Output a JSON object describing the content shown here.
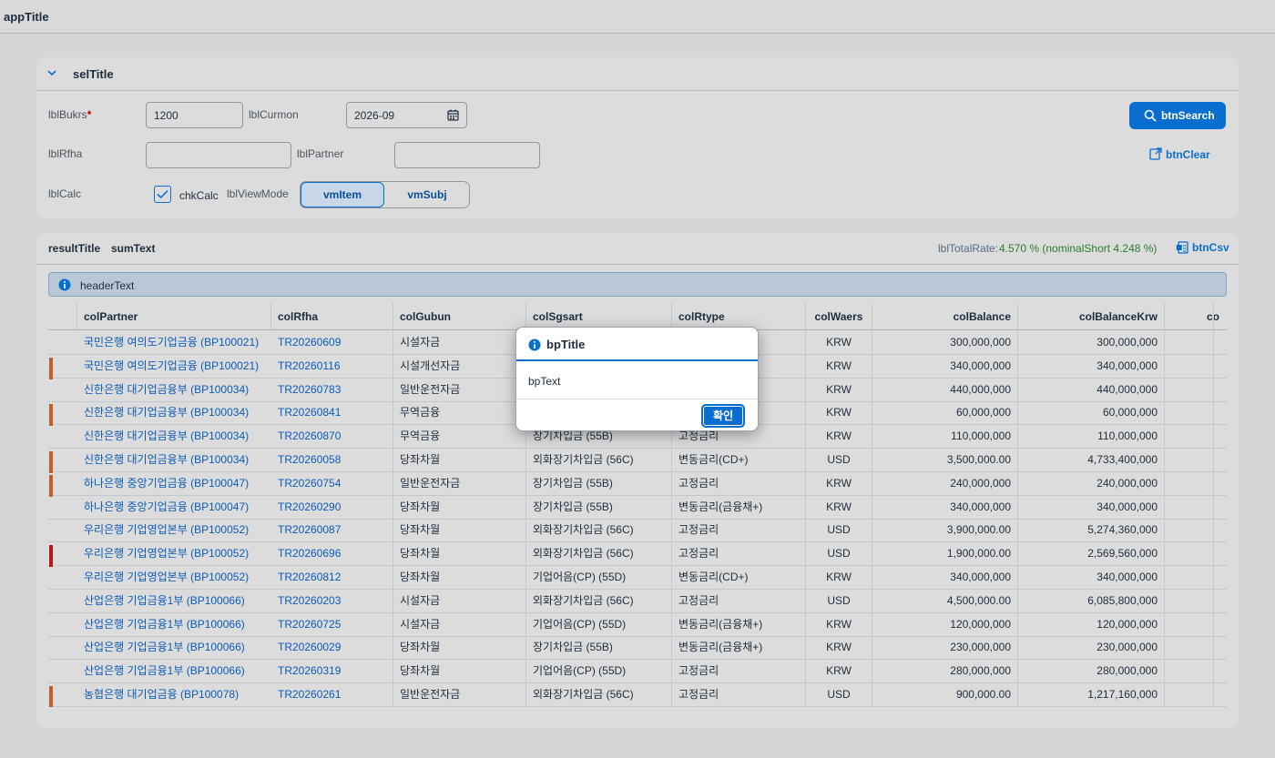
{
  "app": {
    "title": "appTitle"
  },
  "selection": {
    "title": "selTitle",
    "bukrs": {
      "label": "lblBukrs",
      "required_mark": "*",
      "value": "1200"
    },
    "curmon": {
      "label": "lblCurmon",
      "value": "2026-09"
    },
    "rfha": {
      "label": "lblRfha",
      "value": ""
    },
    "partner": {
      "label": "lblPartner",
      "value": ""
    },
    "calc": {
      "label": "lblCalc",
      "checkbox_label": "chkCalc",
      "checked": true
    },
    "viewmode": {
      "label": "lblViewMode",
      "options": [
        "vmItem",
        "vmSubj"
      ],
      "selected": "vmItem"
    },
    "search_label": "btnSearch",
    "clear_label": "btnClear"
  },
  "result": {
    "title": "resultTitle",
    "sum_text": "sumText",
    "total_rate_label": "lblTotalRate:",
    "total_rate_value": "4.570 % (nominalShort 4.248 %)",
    "csv_label": "btnCsv",
    "header_text": "headerText",
    "columns": [
      "colPartner",
      "colRfha",
      "colGubun",
      "colSgsart",
      "colRtype",
      "colWaers",
      "colBalance",
      "colBalanceKrw",
      "co"
    ],
    "rows": [
      {
        "marker": "",
        "partner": "국민은행 여의도기업금융 (BP100021)",
        "rfha": "TR20260609",
        "gubun": "시설자금",
        "sgsart": "",
        "rtype": "",
        "waers": "KRW",
        "balance": "300,000,000",
        "balance_krw": "300,000,000"
      },
      {
        "marker": "#c0602a",
        "partner": "국민은행 여의도기업금융 (BP100021)",
        "rfha": "TR20260116",
        "gubun": "시설개선자금",
        "sgsart": "",
        "rtype": "",
        "waers": "KRW",
        "balance": "340,000,000",
        "balance_krw": "340,000,000"
      },
      {
        "marker": "",
        "partner": "신한은행 대기업금융부 (BP100034)",
        "rfha": "TR20260783",
        "gubun": "일반운전자금",
        "sgsart": "",
        "rtype": "+)",
        "waers": "KRW",
        "balance": "440,000,000",
        "balance_krw": "440,000,000"
      },
      {
        "marker": "#c0602a",
        "partner": "신한은행 대기업금융부 (BP100034)",
        "rfha": "TR20260841",
        "gubun": "무역금융",
        "sgsart": "",
        "rtype": "+)",
        "waers": "KRW",
        "balance": "60,000,000",
        "balance_krw": "60,000,000"
      },
      {
        "marker": "",
        "partner": "신한은행 대기업금융부 (BP100034)",
        "rfha": "TR20260870",
        "gubun": "무역금융",
        "sgsart": "장기차입금 (55B)",
        "rtype": "고정금리",
        "waers": "KRW",
        "balance": "110,000,000",
        "balance_krw": "110,000,000"
      },
      {
        "marker": "#c0602a",
        "partner": "신한은행 대기업금융부 (BP100034)",
        "rfha": "TR20260058",
        "gubun": "당좌차월",
        "sgsart": "외화장기차입금 (56C)",
        "rtype": "변동금리(CD+)",
        "waers": "USD",
        "balance": "3,500,000.00",
        "balance_krw": "4,733,400,000"
      },
      {
        "marker": "#c0602a",
        "partner": "하나은행 중앙기업금융 (BP100047)",
        "rfha": "TR20260754",
        "gubun": "일반운전자금",
        "sgsart": "장기차입금 (55B)",
        "rtype": "고정금리",
        "waers": "KRW",
        "balance": "240,000,000",
        "balance_krw": "240,000,000"
      },
      {
        "marker": "",
        "partner": "하나은행 중앙기업금융 (BP100047)",
        "rfha": "TR20260290",
        "gubun": "당좌차월",
        "sgsart": "장기차입금 (55B)",
        "rtype": "변동금리(금융채+)",
        "waers": "KRW",
        "balance": "340,000,000",
        "balance_krw": "340,000,000"
      },
      {
        "marker": "",
        "partner": "우리은행 기업영업본부 (BP100052)",
        "rfha": "TR20260087",
        "gubun": "당좌차월",
        "sgsart": "외화장기차입금 (56C)",
        "rtype": "고정금리",
        "waers": "USD",
        "balance": "3,900,000.00",
        "balance_krw": "5,274,360,000"
      },
      {
        "marker": "#c0141c",
        "partner": "우리은행 기업영업본부 (BP100052)",
        "rfha": "TR20260696",
        "gubun": "당좌차월",
        "sgsart": "외화장기차입금 (56C)",
        "rtype": "고정금리",
        "waers": "USD",
        "balance": "1,900,000.00",
        "balance_krw": "2,569,560,000"
      },
      {
        "marker": "",
        "partner": "우리은행 기업영업본부 (BP100052)",
        "rfha": "TR20260812",
        "gubun": "당좌차월",
        "sgsart": "기업어음(CP) (55D)",
        "rtype": "변동금리(CD+)",
        "waers": "KRW",
        "balance": "340,000,000",
        "balance_krw": "340,000,000"
      },
      {
        "marker": "",
        "partner": "산업은행 기업금융1부 (BP100066)",
        "rfha": "TR20260203",
        "gubun": "시설자금",
        "sgsart": "외화장기차입금 (56C)",
        "rtype": "고정금리",
        "waers": "USD",
        "balance": "4,500,000.00",
        "balance_krw": "6,085,800,000"
      },
      {
        "marker": "",
        "partner": "산업은행 기업금융1부 (BP100066)",
        "rfha": "TR20260725",
        "gubun": "시설자금",
        "sgsart": "기업어음(CP) (55D)",
        "rtype": "변동금리(금융채+)",
        "waers": "KRW",
        "balance": "120,000,000",
        "balance_krw": "120,000,000"
      },
      {
        "marker": "",
        "partner": "산업은행 기업금융1부 (BP100066)",
        "rfha": "TR20260029",
        "gubun": "당좌차월",
        "sgsart": "장기차입금 (55B)",
        "rtype": "변동금리(금융채+)",
        "waers": "KRW",
        "balance": "230,000,000",
        "balance_krw": "230,000,000"
      },
      {
        "marker": "",
        "partner": "산업은행 기업금융1부 (BP100066)",
        "rfha": "TR20260319",
        "gubun": "당좌차월",
        "sgsart": "기업어음(CP) (55D)",
        "rtype": "고정금리",
        "waers": "KRW",
        "balance": "280,000,000",
        "balance_krw": "280,000,000"
      },
      {
        "marker": "#c0602a",
        "partner": "농협은행 대기업금융 (BP100078)",
        "rfha": "TR20260261",
        "gubun": "일반운전자금",
        "sgsart": "외화장기차입금 (56C)",
        "rtype": "고정금리",
        "waers": "USD",
        "balance": "900,000.00",
        "balance_krw": "1,217,160,000"
      }
    ]
  },
  "dialog": {
    "title": "bpTitle",
    "text": "bpText",
    "ok_label": "확인"
  },
  "colors": {
    "accent": "#0a6ed1",
    "marker_warning": "#c0602a",
    "marker_error": "#c0141c",
    "rate_positive": "#2b7c2b"
  }
}
